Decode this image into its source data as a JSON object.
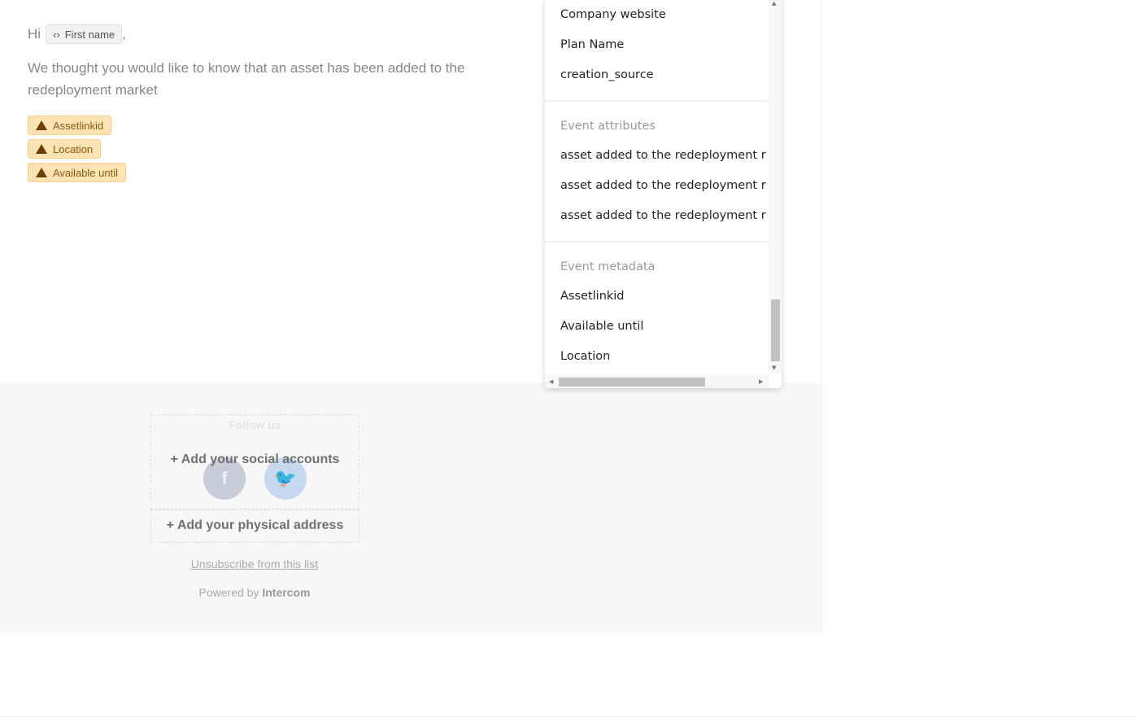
{
  "email": {
    "greeting": "Hi",
    "first_name_chip": "First name",
    "chip_icon": "code-brackets-icon",
    "comma": ",",
    "body": "We thought you would like to know that an asset has been added to the redeployment market",
    "tags": [
      "Assetlinkid",
      "Location",
      "Available until"
    ],
    "tag_icon": "warning-icon",
    "tag_color": "#fde3b4"
  },
  "footer": {
    "follow_us": "Follow us",
    "add_social": "+ Add your social accounts",
    "facebook_glyph": "f",
    "twitter_glyph": "🐦",
    "add_address": "+ Add your physical address",
    "unsubscribe": "Unsubscribe from this list",
    "powered_by": "Powered by",
    "brand": "Intercom"
  },
  "dropdown": {
    "top_items": [
      "Company website",
      "Plan Name",
      "creation_source"
    ],
    "sections": [
      {
        "header": "Event attributes",
        "items": [
          "asset added to the redeployment r",
          "asset added to the redeployment r",
          "asset added to the redeployment r"
        ]
      },
      {
        "header": "Event metadata",
        "items": [
          "Assetlinkid",
          "Available until",
          "Location"
        ]
      }
    ]
  }
}
